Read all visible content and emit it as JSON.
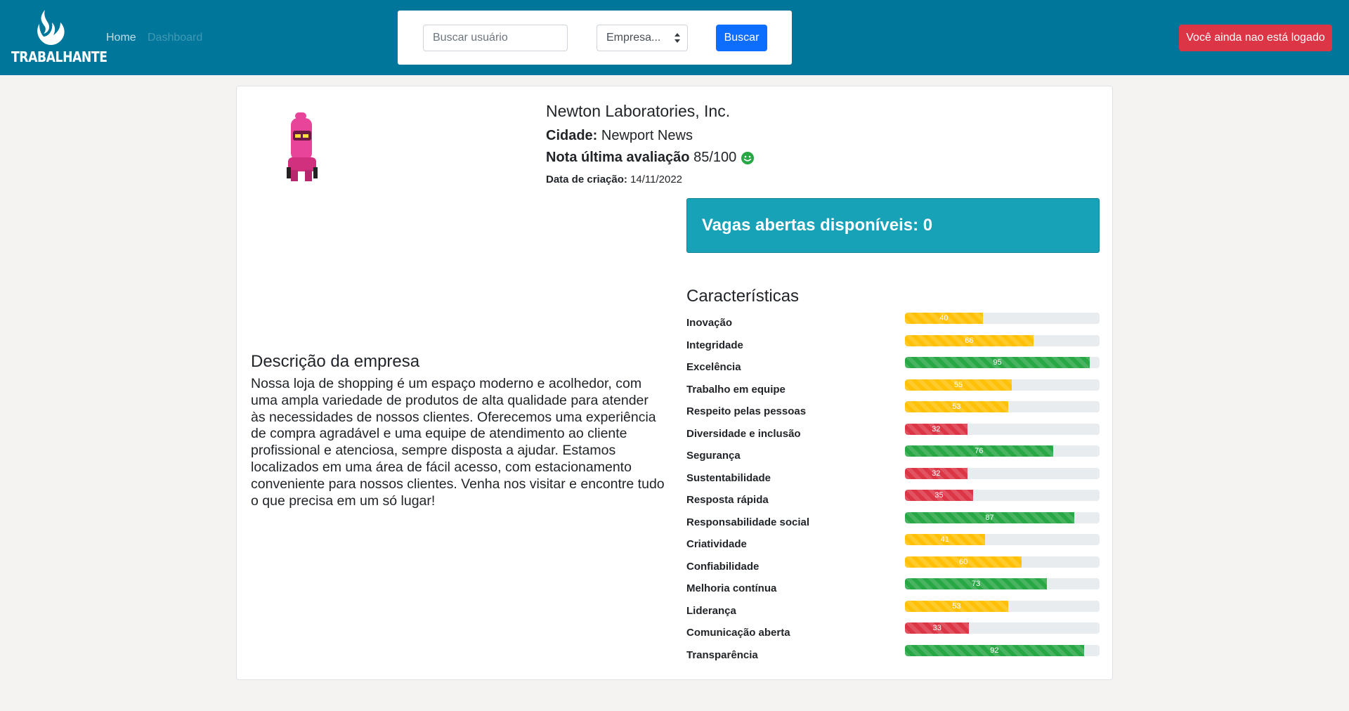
{
  "navbar": {
    "logo_text": "TRABALHANTE",
    "links": [
      {
        "label": "Home"
      },
      {
        "label": "Dashboard"
      }
    ],
    "search_placeholder": "Buscar usuário",
    "select_value": "Empresa...",
    "search_button": "Buscar",
    "login_button": "Você ainda nao está logado"
  },
  "company": {
    "name": "Newton Laboratories, Inc.",
    "city_label": "Cidade:",
    "city": "Newport News",
    "rating_label": "Nota última avaliação",
    "rating": "85/100",
    "created_label": "Data de criação:",
    "created": "14/11/2022",
    "vagas": "Vagas abertas disponíveis: 0",
    "description_title": "Descrição da empresa",
    "description": "Nossa loja de shopping é um espaço moderno e acolhedor, com uma ampla variedade de produtos de alta qualidade para atender às necessidades de nossos clientes. Oferecemos uma experiência de compra agradável e uma equipe de atendimento ao cliente profissional e atenciosa, sempre disposta a ajudar. Estamos localizados em uma área de fácil acesso, com estacionamento conveniente para nossos clientes. Venha nos visitar e encontre tudo o que precisa em um só lugar!"
  },
  "characteristics": {
    "title": "Características",
    "items": [
      {
        "label": "Inovação",
        "value": 40
      },
      {
        "label": "Integridade",
        "value": 66
      },
      {
        "label": "Excelência",
        "value": 95
      },
      {
        "label": "Trabalho em equipe",
        "value": 55
      },
      {
        "label": "Respeito pelas pessoas",
        "value": 53
      },
      {
        "label": "Diversidade e inclusão",
        "value": 32
      },
      {
        "label": "Segurança",
        "value": 76
      },
      {
        "label": "Sustentabilidade",
        "value": 32
      },
      {
        "label": "Resposta rápida",
        "value": 35
      },
      {
        "label": "Responsabilidade social",
        "value": 87
      },
      {
        "label": "Criatividade",
        "value": 41
      },
      {
        "label": "Confiabilidade",
        "value": 60
      },
      {
        "label": "Melhoria contínua",
        "value": 73
      },
      {
        "label": "Liderança",
        "value": 53
      },
      {
        "label": "Comunicação aberta",
        "value": 33
      },
      {
        "label": "Transparência",
        "value": 92
      }
    ]
  },
  "colors": {
    "navbar": "#00769b",
    "primary": "#0d6efd",
    "danger": "#dc3545",
    "warning": "#ffc107",
    "success": "#28a745",
    "info": "#17a2b8"
  },
  "icons": {
    "logo": "flame-icon",
    "rating": "smiley-icon",
    "select": "updown-arrows-icon"
  }
}
